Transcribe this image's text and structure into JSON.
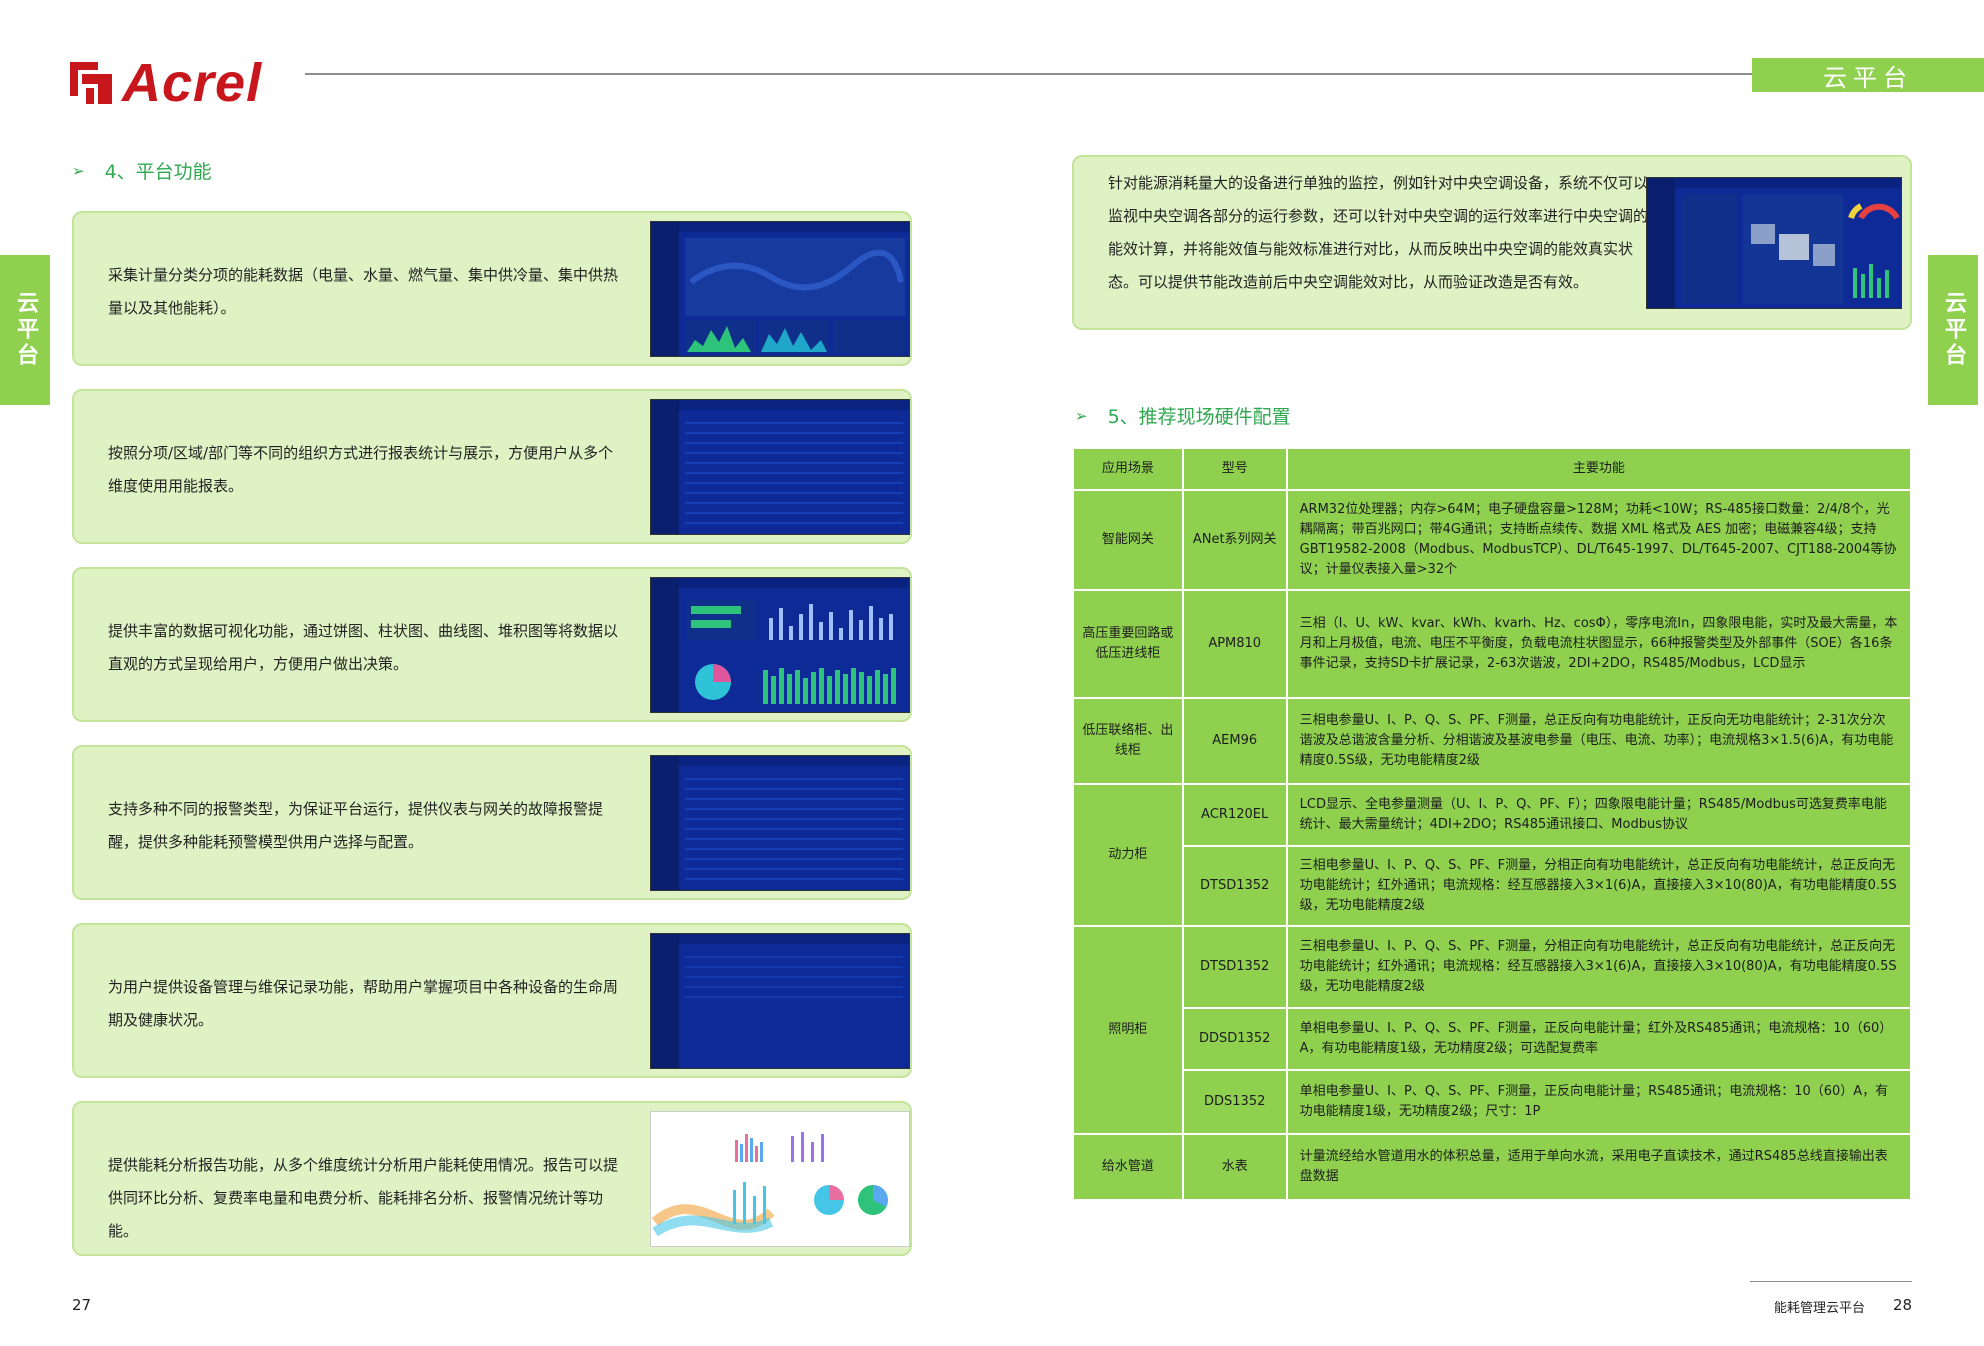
{
  "brand": {
    "name": "Acrel",
    "primary_color": "#c8161d",
    "accent_color": "#8fd14f"
  },
  "header_tab": "云平台",
  "side_tab": "云平台",
  "section4": {
    "title": "4、平台功能",
    "cards": [
      {
        "text": "采集计量分类分项的能耗数据（电量、水量、燃气量、集中供冷量、集中供热量以及其他能耗）。"
      },
      {
        "text": "按照分项/区域/部门等不同的组织方式进行报表统计与展示，方便用户从多个维度使用用能报表。"
      },
      {
        "text": "提供丰富的数据可视化功能，通过饼图、柱状图、曲线图、堆积图等将数据以直观的方式呈现给用户，方便用户做出决策。"
      },
      {
        "text": "支持多种不同的报警类型，为保证平台运行，提供仪表与网关的故障报警提醒，提供多种能耗预警模型供用户选择与配置。"
      },
      {
        "text": "为用户提供设备管理与维保记录功能，帮助用户掌握项目中各种设备的生命周期及健康状况。"
      },
      {
        "text": "提供能耗分析报告功能，从多个维度统计分析用户能耗使用情况。报告可以提供同环比分析、复费率电量和电费分析、能耗排名分析、报警情况统计等功能。"
      }
    ],
    "right_card": {
      "text": "针对能源消耗量大的设备进行单独的监控，例如针对中央空调设备，系统不仅可以监视中央空调各部分的运行参数，还可以针对中央空调的运行效率进行中央空调的能效计算，并将能效值与能效标准进行对比，从而反映出中央空调的能效真实状态。可以提供节能改造前后中央空调能效对比，从而验证改造是否有效。"
    }
  },
  "section5": {
    "title": "5、推荐现场硬件配置",
    "columns": [
      "应用场景",
      "型号",
      "主要功能"
    ],
    "rows": [
      {
        "scene": "智能网关",
        "model": "ANet系列网关",
        "func": "ARM32位处理器；内存>64M；电子硬盘容量>128M；功耗<10W；RS-485接口数量：2/4/8个，光耦隔离；带百兆网口；带4G通讯；支持断点续传、数据 XML 格式及 AES 加密；电磁兼容4级；支持GBT19582-2008（Modbus、ModbusTCP）、DL/T645-1997、DL/T645-2007、CJT188-2004等协议；计量仪表接入量>32个"
      },
      {
        "scene": "高压重要回路或低压进线柜",
        "model": "APM810",
        "func": "三相（I、U、kW、kvar、kWh、kvarh、Hz、cosΦ），零序电流In，四象限电能，实时及最大需量，本月和上月极值，电流、电压不平衡度，负载电流柱状图显示，66种报警类型及外部事件（SOE）各16条事件记录，支持SD卡扩展记录，2-63次谐波，2DI+2DO，RS485/Modbus，LCD显示"
      },
      {
        "scene": "低压联络柜、出线柜",
        "model": "AEM96",
        "func": "三相电参量U、I、P、Q、S、PF、F测量，总正反向有功电能统计，正反向无功电能统计；2-31次分次谐波及总谐波含量分析、分相谐波及基波电参量（电压、电流、功率）；电流规格3×1.5(6)A，有功电能精度0.5S级，无功电能精度2级"
      },
      {
        "scene": "动力柜",
        "model": "ACR120EL",
        "func": "LCD显示、全电参量测量（U、I、P、Q、PF、F）；四象限电能计量；RS485/Modbus可选复费率电能统计、最大需量统计；4DI+2DO；RS485通讯接口、Modbus协议"
      },
      {
        "model": "DTSD1352",
        "func": "三相电参量U、I、P、Q、S、PF、F测量，分相正向有功电能统计，总正反向有功电能统计，总正反向无功电能统计；红外通讯；电流规格：经互感器接入3×1(6)A，直接接入3×10(80)A，有功电能精度0.5S级，无功电能精度2级"
      },
      {
        "scene": "照明柜",
        "model": "DTSD1352",
        "func": "三相电参量U、I、P、Q、S、PF、F测量，分相正向有功电能统计，总正反向有功电能统计，总正反向无功电能统计；红外通讯；电流规格：经互感器接入3×1(6)A，直接接入3×10(80)A，有功电能精度0.5S级，无功电能精度2级"
      },
      {
        "model": "DDSD1352",
        "func": "单相电参量U、I、P、Q、S、PF、F测量，正反向电能计量；红外及RS485通讯；电流规格：10（60）A，有功电能精度1级，无功精度2级；可选配复费率"
      },
      {
        "model": "DDS1352",
        "func": "单相电参量U、I、P、Q、S、PF、F测量，正反向电能计量；RS485通讯；电流规格：10（60）A，有功电能精度1级，无功精度2级；尺寸：1P"
      },
      {
        "scene": "给水管道",
        "model": "水表",
        "func": "计量流经给水管道用水的体积总量，适用于单向水流，采用电子直读技术，通过RS485总线直接输出表盘数据"
      }
    ]
  },
  "footer": {
    "left_page": "27",
    "right_page": "28",
    "right_caption": "能耗管理云平台"
  }
}
